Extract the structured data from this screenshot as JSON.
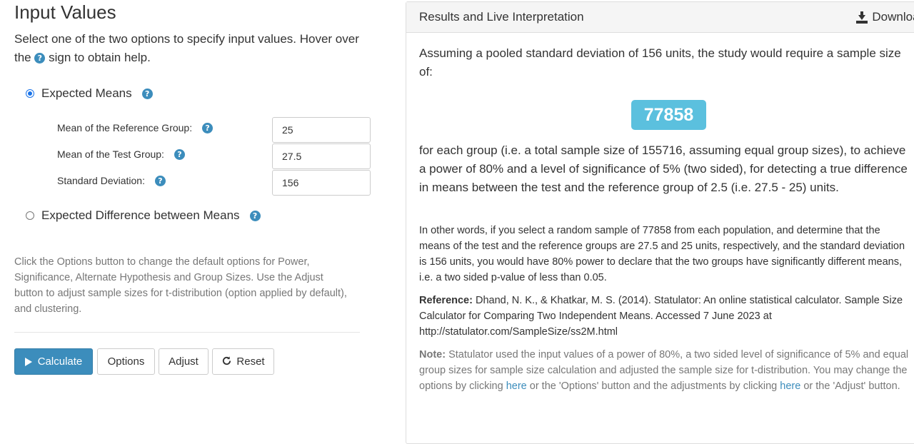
{
  "left": {
    "title": "Input Values",
    "intro_part1": "Select one of the two options to specify input values. Hover over the",
    "intro_part2": "sign to obtain help.",
    "option_means": "Expected Means",
    "option_difference": "Expected Difference between Means",
    "fields": [
      {
        "label": "Mean of the Reference Group:",
        "value": "25"
      },
      {
        "label": "Mean of the Test Group:",
        "value": "27.5"
      },
      {
        "label": "Standard Deviation:",
        "value": "156"
      }
    ],
    "note": "Click the Options button to change the default options for Power, Significance, Alternate Hypothesis and Group Sizes. Use the Adjust button to adjust sample sizes for t-distribution (option applied by default), and clustering.",
    "buttons": {
      "calculate": "Calculate",
      "options": "Options",
      "adjust": "Adjust",
      "reset": "Reset"
    },
    "help_glyph": "?"
  },
  "right": {
    "header_title": "Results and Live Interpretation",
    "download_label": "Download",
    "para1": "Assuming a pooled standard deviation of 156 units, the study would require a sample size of:",
    "result_value": "77858",
    "para2": "for each group (i.e. a total sample size of 155716, assuming equal group sizes), to achieve a power of 80% and a level of significance of 5% (two sided), for detecting a true difference in means between the test and the reference group of 2.5 (i.e. 27.5 - 25) units.",
    "para3": "In other words, if you select a random sample of 77858 from each population, and determine that the means of the test and the reference groups are 27.5 and 25 units, respectively, and the standard deviation is 156 units, you would have 80% power to declare that the two groups have significantly different means, i.e. a two sided p-value of less than 0.05.",
    "reference_label": "Reference:",
    "reference_text": "Dhand, N. K., & Khatkar, M. S. (2014). Statulator: An online statistical calculator. Sample Size Calculator for Comparing Two Independent Means. Accessed 7 June 2023 at http://statulator.com/SampleSize/ss2M.html",
    "note_label": "Note:",
    "note_text1": "Statulator used the input values of a power of 80%, a two sided level of significance of 5% and equal group sizes for sample size calculation and adjusted the sample size for t-distribution. You may change the options by clicking",
    "note_link1": "here",
    "note_text2": "or the 'Options' button and the adjustments by clicking",
    "note_link2": "here",
    "note_text3": "or the 'Adjust' button."
  },
  "colors": {
    "primary": "#3c8dbc",
    "result_badge": "#5bc0de",
    "radio_selected": "#1a73e8"
  }
}
